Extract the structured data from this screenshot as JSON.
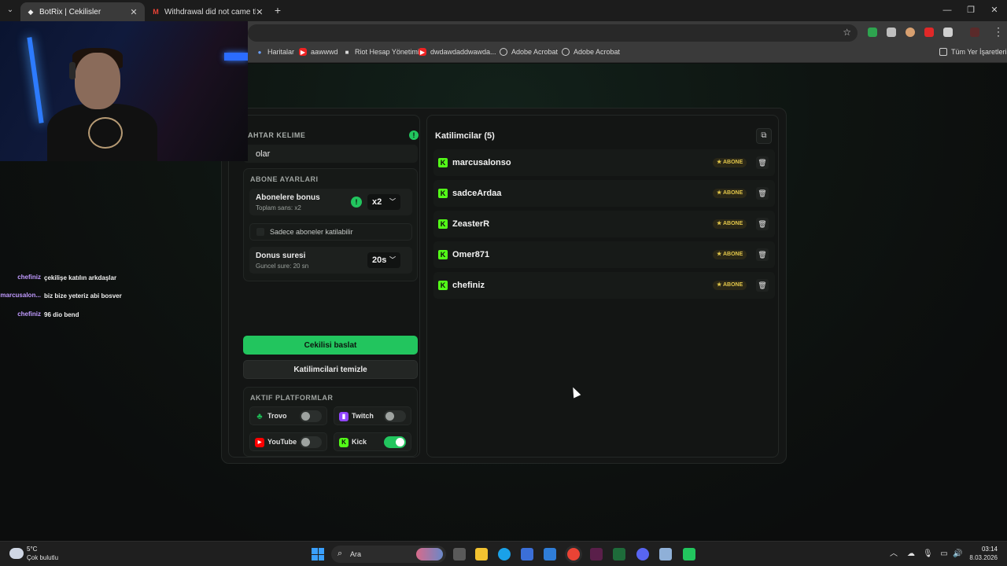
{
  "browser": {
    "tabs": [
      {
        "title": "BotRix | Cekilisler",
        "active": true
      },
      {
        "title": "Withdrawal did not came throu",
        "active": false
      }
    ],
    "bookmarks": [
      {
        "label": "Haritalar",
        "icon": "map-pin-icon"
      },
      {
        "label": "aawwwd",
        "icon": "youtube-icon"
      },
      {
        "label": "Riot Hesap Yönetimi",
        "icon": "riot-icon"
      },
      {
        "label": "dwdawdaddwawda...",
        "icon": "youtube-icon"
      },
      {
        "label": "Adobe Acrobat",
        "icon": "globe-icon"
      },
      {
        "label": "Adobe Acrobat",
        "icon": "globe-icon"
      }
    ],
    "all_bookmarks_label": "Tüm Yer İşaretleri"
  },
  "keyword": {
    "label": "ANAHTAR KELIME",
    "label_visible": "AHTAR KELIME",
    "value": "olar"
  },
  "subscriber_settings": {
    "title": "ABONE AYARLARI",
    "bonus": {
      "title": "Abonelere bonus",
      "sub": "Toplam sans: x2",
      "value": "x2"
    },
    "only_subs_label": "Sadece aboneler katilabilir",
    "bonus_duration": {
      "title": "Donus suresi",
      "sub": "Guncel sure: 20 sn",
      "value": "20s"
    }
  },
  "buttons": {
    "start": "Cekilisi baslat",
    "clear": "Katilimcilari temizle"
  },
  "platforms": {
    "title": "AKTIF PLATFORMLAR",
    "items": [
      {
        "name": "Trovo",
        "on": false,
        "color": "#1db954"
      },
      {
        "name": "Twitch",
        "on": false,
        "color": "#9146ff"
      },
      {
        "name": "YouTube",
        "on": false,
        "color": "#ff0000"
      },
      {
        "name": "Kick",
        "on": true,
        "color": "#53fc18"
      }
    ]
  },
  "participants": {
    "title": "Katilimcilar (5)",
    "badge": "ABONE",
    "list": [
      "marcusalonso",
      "sadceArdaa",
      "ZeasterR",
      "Omer871",
      "chefiniz"
    ]
  },
  "chat": [
    {
      "user": "chefiniz",
      "msg": "çekilişe katılın arkdaşlar"
    },
    {
      "user": "marcusalon...",
      "msg": "biz bize yeteriz abi bosver"
    },
    {
      "user": "chefiniz",
      "msg": "96 dio bend"
    }
  ],
  "taskbar": {
    "weather_temp": "5°C",
    "weather_desc": "Çok bulutlu",
    "search_placeholder": "Ara",
    "time": "03:14",
    "date": "8.03.2026"
  },
  "colors": {
    "accent": "#22c55e",
    "kick": "#53fc18",
    "badge_gold": "#e2c64a"
  }
}
